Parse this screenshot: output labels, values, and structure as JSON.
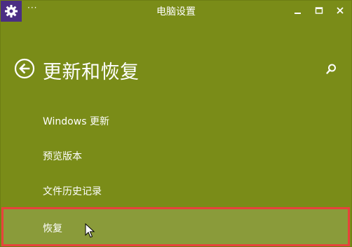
{
  "window": {
    "title": "电脑设置",
    "menu_dots": "···"
  },
  "header": {
    "title": "更新和恢复"
  },
  "menu": {
    "items": [
      {
        "label": "Windows 更新"
      },
      {
        "label": "预览版本"
      },
      {
        "label": "文件历史记录"
      },
      {
        "label": "恢复"
      }
    ],
    "selected_index": 3
  },
  "colors": {
    "background": "#7a8c18",
    "app_icon_bg": "#4b2e83",
    "selected_bg": "#8a9b3a",
    "highlight_border": "#e8423c",
    "text": "#ffffff"
  },
  "icons": {
    "app": "gear-icon",
    "back": "back-arrow-circle-icon",
    "search": "search-icon",
    "minimize": "minimize-icon",
    "maximize": "maximize-icon",
    "close": "close-icon"
  }
}
